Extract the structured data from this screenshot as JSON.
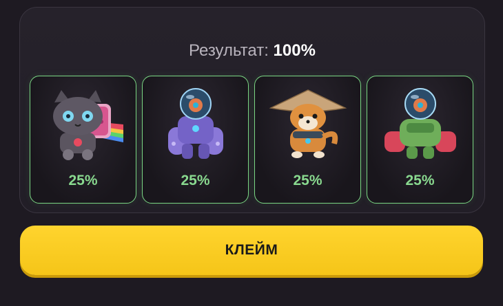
{
  "result": {
    "label": "Результат:",
    "value": "100%"
  },
  "cards": [
    {
      "name": "cat-nft",
      "percent": "25%"
    },
    {
      "name": "purple-robot-nft",
      "percent": "25%"
    },
    {
      "name": "shiba-dog-nft",
      "percent": "25%"
    },
    {
      "name": "green-robot-nft",
      "percent": "25%"
    }
  ],
  "claim_button": {
    "label": "КЛЕЙМ"
  },
  "colors": {
    "accent_green": "#7bd784",
    "button_yellow": "#f5c518",
    "background": "#1e1a22"
  }
}
